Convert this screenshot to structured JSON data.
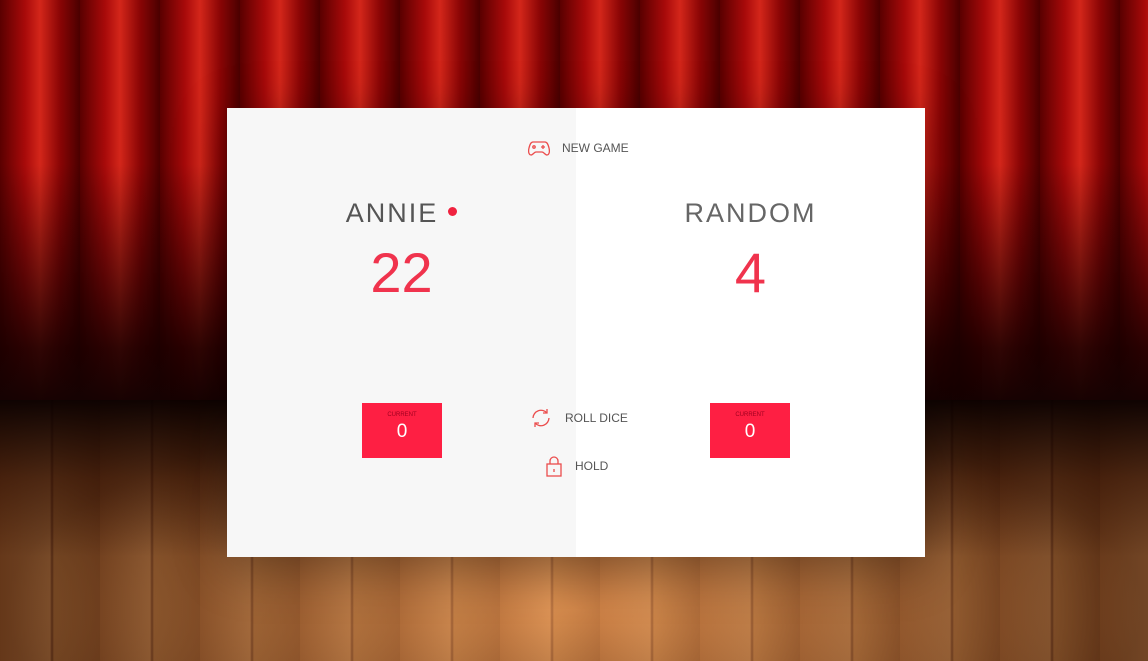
{
  "controls": {
    "new_game": "NEW GAME",
    "roll_dice": "ROLL DICE",
    "hold": "HOLD"
  },
  "players": [
    {
      "name": "ANNIE",
      "score": "22",
      "current_label": "CURRENT",
      "current": "0",
      "active": true
    },
    {
      "name": "RANDOM",
      "score": "4",
      "current_label": "CURRENT",
      "current": "0",
      "active": false
    }
  ],
  "colors": {
    "accent": "#fe1f43",
    "active_panel": "#f7f7f7"
  },
  "icons": {
    "new_game": "gamepad-icon",
    "roll_dice": "refresh-icon",
    "hold": "lock-icon"
  }
}
